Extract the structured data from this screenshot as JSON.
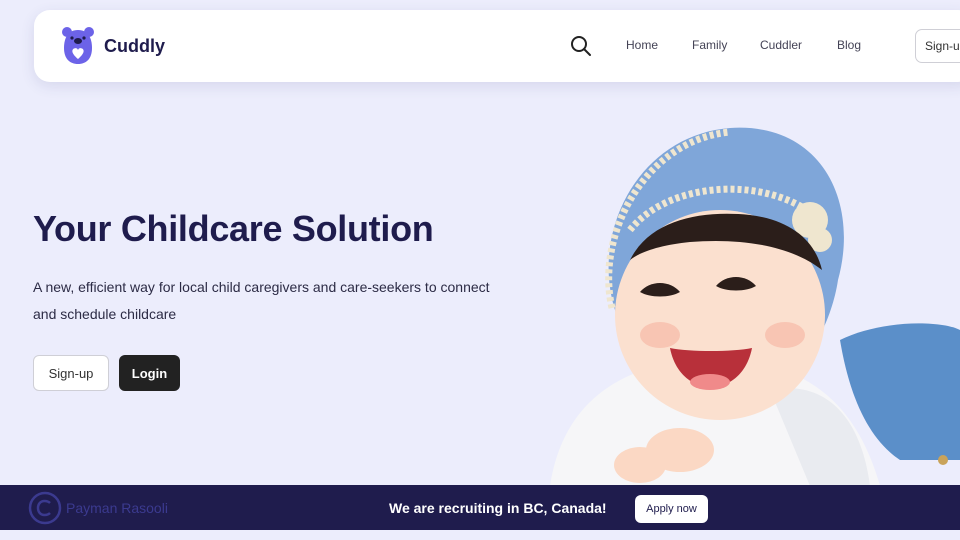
{
  "brand": {
    "name": "Cuddly",
    "logo_icon": "bear-heart-icon",
    "accent": "#6c63e8"
  },
  "nav": {
    "search_icon": "search-icon",
    "links": [
      "Home",
      "Family",
      "Cuddler",
      "Blog"
    ],
    "signup_label": "Sign-up"
  },
  "hero": {
    "title": "Your Childcare Solution",
    "subtitle": "A new, efficient way for local child caregivers and care-seekers to connect and schedule childcare",
    "signup_label": "Sign-up",
    "login_label": "Login"
  },
  "banner": {
    "text": "We are recruiting in BC, Canada!",
    "apply_label": "Apply now",
    "background": "#1f1c4d"
  },
  "watermark": {
    "text": "Payman Rasooli",
    "icon": "copyright-icon"
  }
}
